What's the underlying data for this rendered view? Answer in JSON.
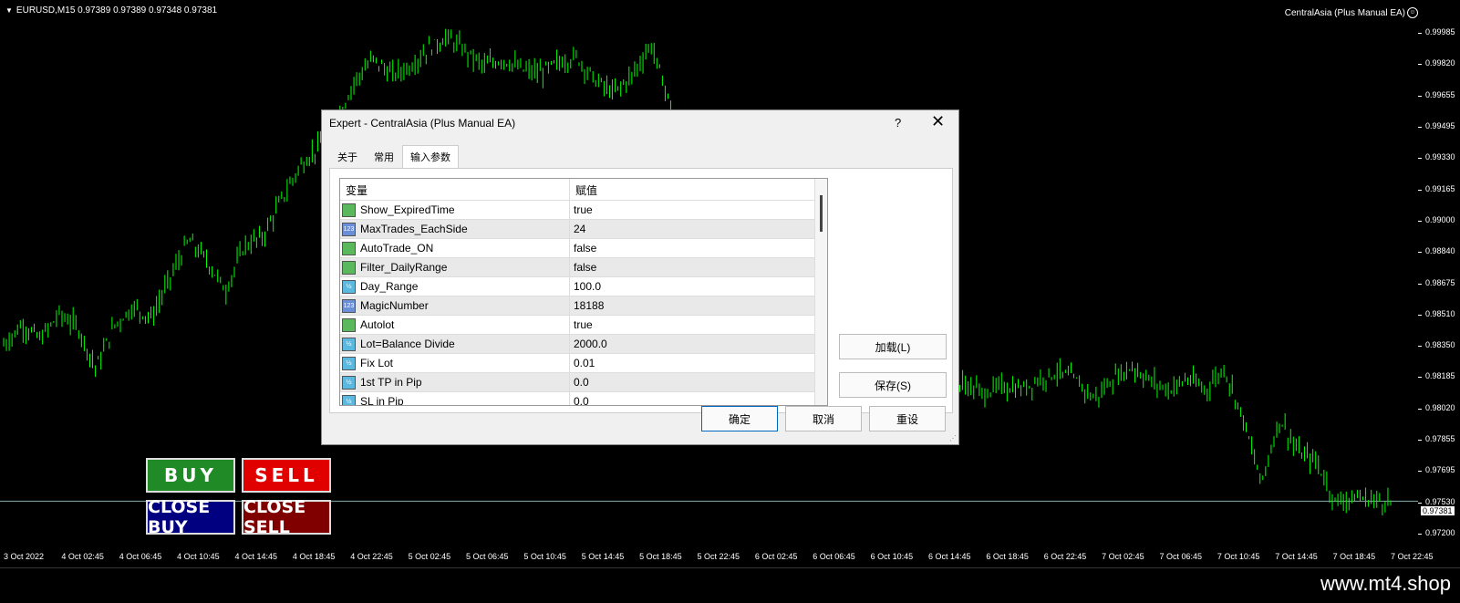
{
  "chart": {
    "symbol_line": "EURUSD,M15  0.97389 0.97389 0.97348 0.97381",
    "ea_label": "CentralAsia (Plus Manual EA)",
    "ea_smiley": "☺",
    "current_price": "0.97381",
    "price_labels": [
      "0.99985",
      "0.99820",
      "0.99655",
      "0.99495",
      "0.99330",
      "0.99165",
      "0.99000",
      "0.98840",
      "0.98675",
      "0.98510",
      "0.98350",
      "0.98185",
      "0.98020",
      "0.97855",
      "0.97695",
      "0.97530",
      "0.97200"
    ],
    "time_labels": [
      "3 Oct 2022",
      "4 Oct 02:45",
      "4 Oct 06:45",
      "4 Oct 10:45",
      "4 Oct 14:45",
      "4 Oct 18:45",
      "4 Oct 22:45",
      "5 Oct 02:45",
      "5 Oct 06:45",
      "5 Oct 10:45",
      "5 Oct 14:45",
      "5 Oct 18:45",
      "5 Oct 22:45",
      "6 Oct 02:45",
      "6 Oct 06:45",
      "6 Oct 10:45",
      "6 Oct 14:45",
      "6 Oct 18:45",
      "6 Oct 22:45",
      "7 Oct 02:45",
      "7 Oct 06:45",
      "7 Oct 10:45",
      "7 Oct 14:45",
      "7 Oct 18:45",
      "7 Oct 22:45"
    ],
    "candle_color": "#00ff00",
    "price_path": [
      0.9825,
      0.9836,
      0.9828,
      0.9842,
      0.9835,
      0.9812,
      0.9836,
      0.9846,
      0.984,
      0.9862,
      0.9883,
      0.9872,
      0.9855,
      0.988,
      0.9885,
      0.9905,
      0.9924,
      0.9935,
      0.995,
      0.9972,
      0.9984,
      0.9975,
      0.998,
      0.999,
      0.9996,
      0.9988,
      0.998,
      0.9984,
      0.9978,
      0.9976,
      0.9982,
      0.9985,
      0.9972,
      0.9965,
      0.9975,
      0.9992,
      0.996,
      0.993,
      0.99,
      0.988,
      0.9862,
      0.985,
      0.9835,
      0.982,
      0.981,
      0.9805,
      0.982,
      0.983,
      0.9848,
      0.9815,
      0.9805,
      0.98,
      0.9803,
      0.9798,
      0.9802,
      0.98,
      0.9806,
      0.981,
      0.9805,
      0.9795,
      0.9806,
      0.9813,
      0.9805,
      0.98,
      0.9806,
      0.98,
      0.9812,
      0.9785,
      0.9748,
      0.9784,
      0.9765,
      0.976,
      0.9738,
      0.974,
      0.9739,
      0.9738
    ]
  },
  "trade_buttons": {
    "buy": "BUY",
    "sell": "SELL",
    "close_buy": "CLOSE BUY",
    "close_sell": "CLOSE SELL"
  },
  "dialog": {
    "title": "Expert - CentralAsia (Plus Manual EA)",
    "help": "?",
    "close": "✕",
    "tabs": [
      "关于",
      "常用",
      "输入参数"
    ],
    "active_tab": "输入参数",
    "columns": {
      "variable": "变量",
      "value": "赋值"
    },
    "params": [
      {
        "name": "Show_ExpiredTime",
        "value": "true",
        "type": "bool",
        "icon": "bool-icon"
      },
      {
        "name": "MaxTrades_EachSide",
        "value": "24",
        "type": "int",
        "icon": "int-icon"
      },
      {
        "name": "AutoTrade_ON",
        "value": "false",
        "type": "bool",
        "icon": "bool-icon"
      },
      {
        "name": "Filter_DailyRange",
        "value": "false",
        "type": "bool",
        "icon": "bool-icon"
      },
      {
        "name": "Day_Range",
        "value": "100.0",
        "type": "dbl",
        "icon": "double-icon"
      },
      {
        "name": "MagicNumber",
        "value": "18188",
        "type": "int",
        "icon": "int-icon"
      },
      {
        "name": "Autolot",
        "value": "true",
        "type": "bool",
        "icon": "bool-icon"
      },
      {
        "name": "Lot=Balance Divide",
        "value": "2000.0",
        "type": "dbl",
        "icon": "double-icon"
      },
      {
        "name": "Fix Lot",
        "value": "0.01",
        "type": "dbl",
        "icon": "double-icon"
      },
      {
        "name": "1st TP in Pip",
        "value": "0.0",
        "type": "dbl",
        "icon": "double-icon"
      },
      {
        "name": "SL in Pip",
        "value": "0.0",
        "type": "dbl",
        "icon": "double-icon"
      }
    ],
    "icon_text": {
      "bool": "",
      "int": "123",
      "dbl": "½"
    },
    "load_label": "加载(L)",
    "save_label": "保存(S)",
    "ok_label": "确定",
    "cancel_label": "取消",
    "reset_label": "重设"
  },
  "footer": {
    "site": "www.mt4.shop"
  }
}
